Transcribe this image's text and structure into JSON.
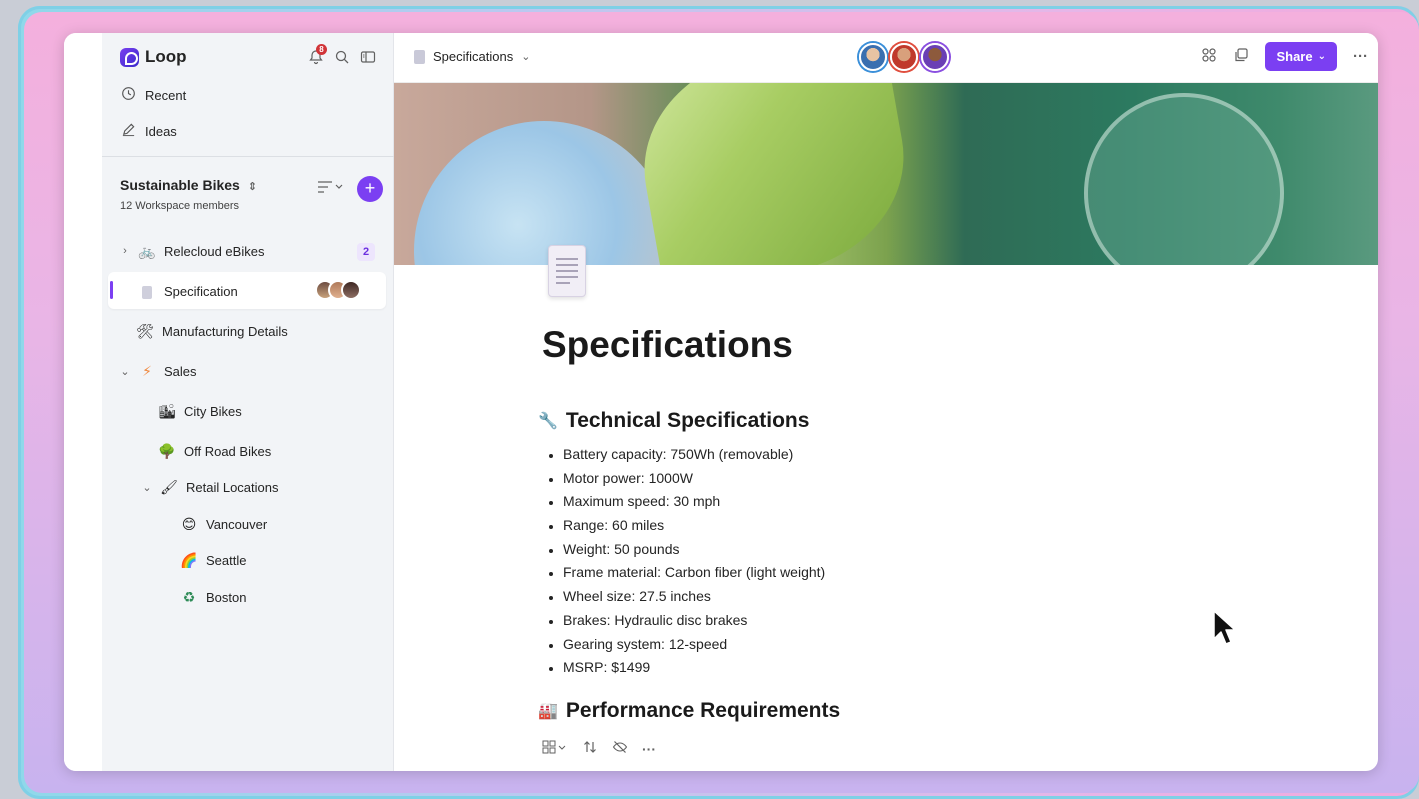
{
  "app": {
    "name": "Loop",
    "notifications": "8"
  },
  "sidebar": {
    "nav": [
      {
        "label": "Recent",
        "icon": "clock-icon"
      },
      {
        "label": "Ideas",
        "icon": "pencil-icon"
      }
    ],
    "workspace": {
      "title": "Sustainable Bikes",
      "members": "12 Workspace members"
    },
    "tree": [
      {
        "label": "Relecloud eBikes",
        "icon": "bike-icon",
        "badge": "2"
      },
      {
        "label": "Specification",
        "icon": "document-icon"
      },
      {
        "label": "Manufacturing Details",
        "icon": "tools-icon"
      },
      {
        "label": "Sales",
        "icon": "lightning-icon"
      },
      {
        "label": "City Bikes",
        "icon": "city-icon"
      },
      {
        "label": "Off Road Bikes",
        "icon": "tree-icon"
      },
      {
        "label": "Retail Locations",
        "icon": "brush-icon"
      },
      {
        "label": "Vancouver",
        "icon": "face-icon"
      },
      {
        "label": "Seattle",
        "icon": "rainbow-icon"
      },
      {
        "label": "Boston",
        "icon": "recycle-icon"
      }
    ]
  },
  "topbar": {
    "page_title": "Specifications",
    "share_label": "Share"
  },
  "page": {
    "title": "Specifications",
    "section1": "Technical Specifications",
    "specs": [
      "Battery capacity: 750Wh (removable)",
      "Motor power: 1000W",
      "Maximum speed: 30 mph",
      "Range: 60 miles",
      "Weight: 50 pounds",
      "Frame material: Carbon fiber (light weight)",
      "Wheel size: 27.5 inches",
      "Brakes: Hydraulic disc brakes",
      "Gearing system: 12-speed",
      "MSRP: $1499"
    ],
    "section2": "Performance Requirements"
  },
  "colors": {
    "accent": "#7b3ff2",
    "badge_red": "#d13438"
  }
}
